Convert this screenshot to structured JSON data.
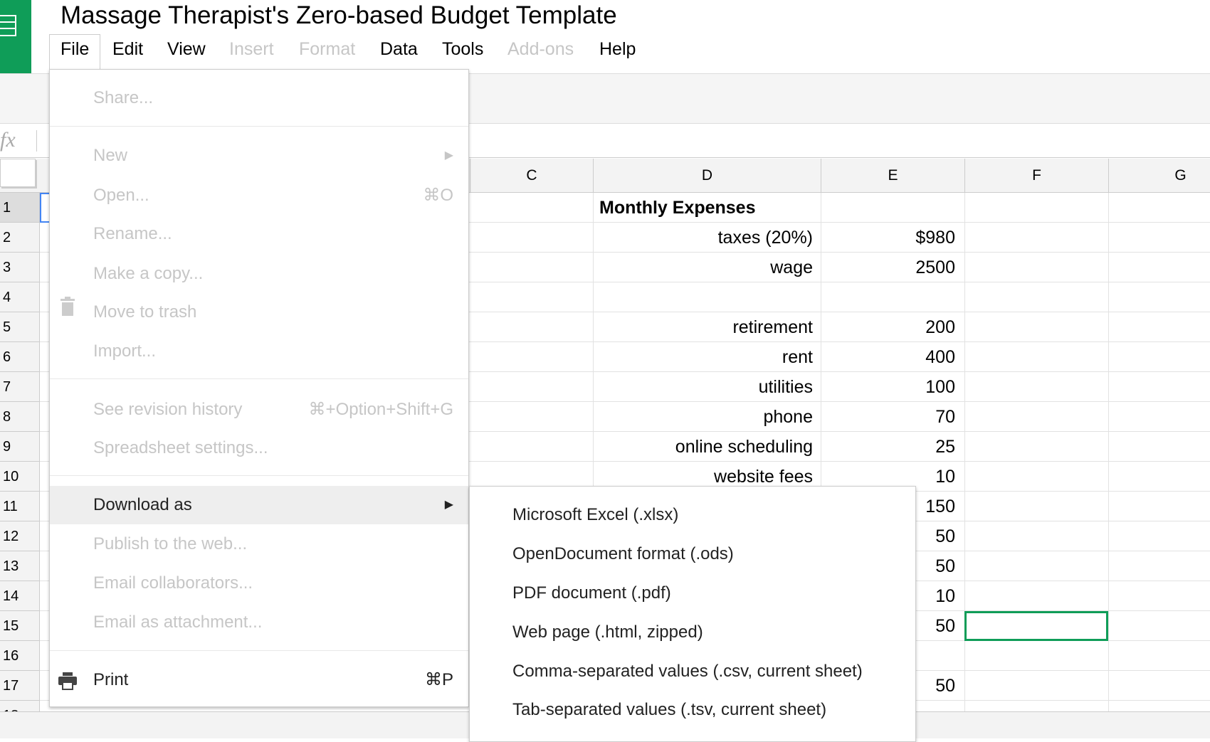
{
  "app": {
    "title": "Massage Therapist's Zero-based Budget Template",
    "brand_color": "#0f9d58"
  },
  "menubar": [
    {
      "label": "File",
      "enabled": true
    },
    {
      "label": "Edit",
      "enabled": true
    },
    {
      "label": "View",
      "enabled": true
    },
    {
      "label": "Insert",
      "enabled": false
    },
    {
      "label": "Format",
      "enabled": false
    },
    {
      "label": "Data",
      "enabled": true
    },
    {
      "label": "Tools",
      "enabled": true
    },
    {
      "label": "Add-ons",
      "enabled": false
    },
    {
      "label": "Help",
      "enabled": true
    }
  ],
  "formula_bar": {
    "icon": "fx"
  },
  "columns": [
    "C",
    "D",
    "E",
    "F",
    "G"
  ],
  "rows": [
    "1",
    "2",
    "3",
    "4",
    "5",
    "6",
    "7",
    "8",
    "9",
    "10",
    "11",
    "12",
    "13",
    "14",
    "15",
    "16",
    "17"
  ],
  "cells": {
    "D": [
      "Monthly Expenses",
      "taxes (20%)",
      "wage",
      "",
      "retirement",
      "rent",
      "utilities",
      "phone",
      "online scheduling",
      "website fees"
    ],
    "E": [
      "",
      "$980",
      "2500",
      "",
      "200",
      "400",
      "100",
      "70",
      "25",
      "10",
      "150",
      "50",
      "50",
      "10",
      "50",
      "",
      "50"
    ]
  },
  "selected_cell": "F15",
  "file_menu": {
    "share": "Share...",
    "new": "New",
    "open": "Open...",
    "open_shortcut": "⌘O",
    "rename": "Rename...",
    "make_copy": "Make a copy...",
    "trash": "Move to trash",
    "import": "Import...",
    "revision": "See revision history",
    "revision_shortcut": "⌘+Option+Shift+G",
    "settings": "Spreadsheet settings...",
    "download": "Download as",
    "publish": "Publish to the web...",
    "email_collab": "Email collaborators...",
    "email_attach": "Email as attachment...",
    "print": "Print",
    "print_shortcut": "⌘P"
  },
  "download_menu": [
    "Microsoft Excel (.xlsx)",
    "OpenDocument format (.ods)",
    "PDF document (.pdf)",
    "Web page (.html, zipped)",
    "Comma-separated values (.csv, current sheet)",
    "Tab-separated values (.tsv, current sheet)"
  ]
}
